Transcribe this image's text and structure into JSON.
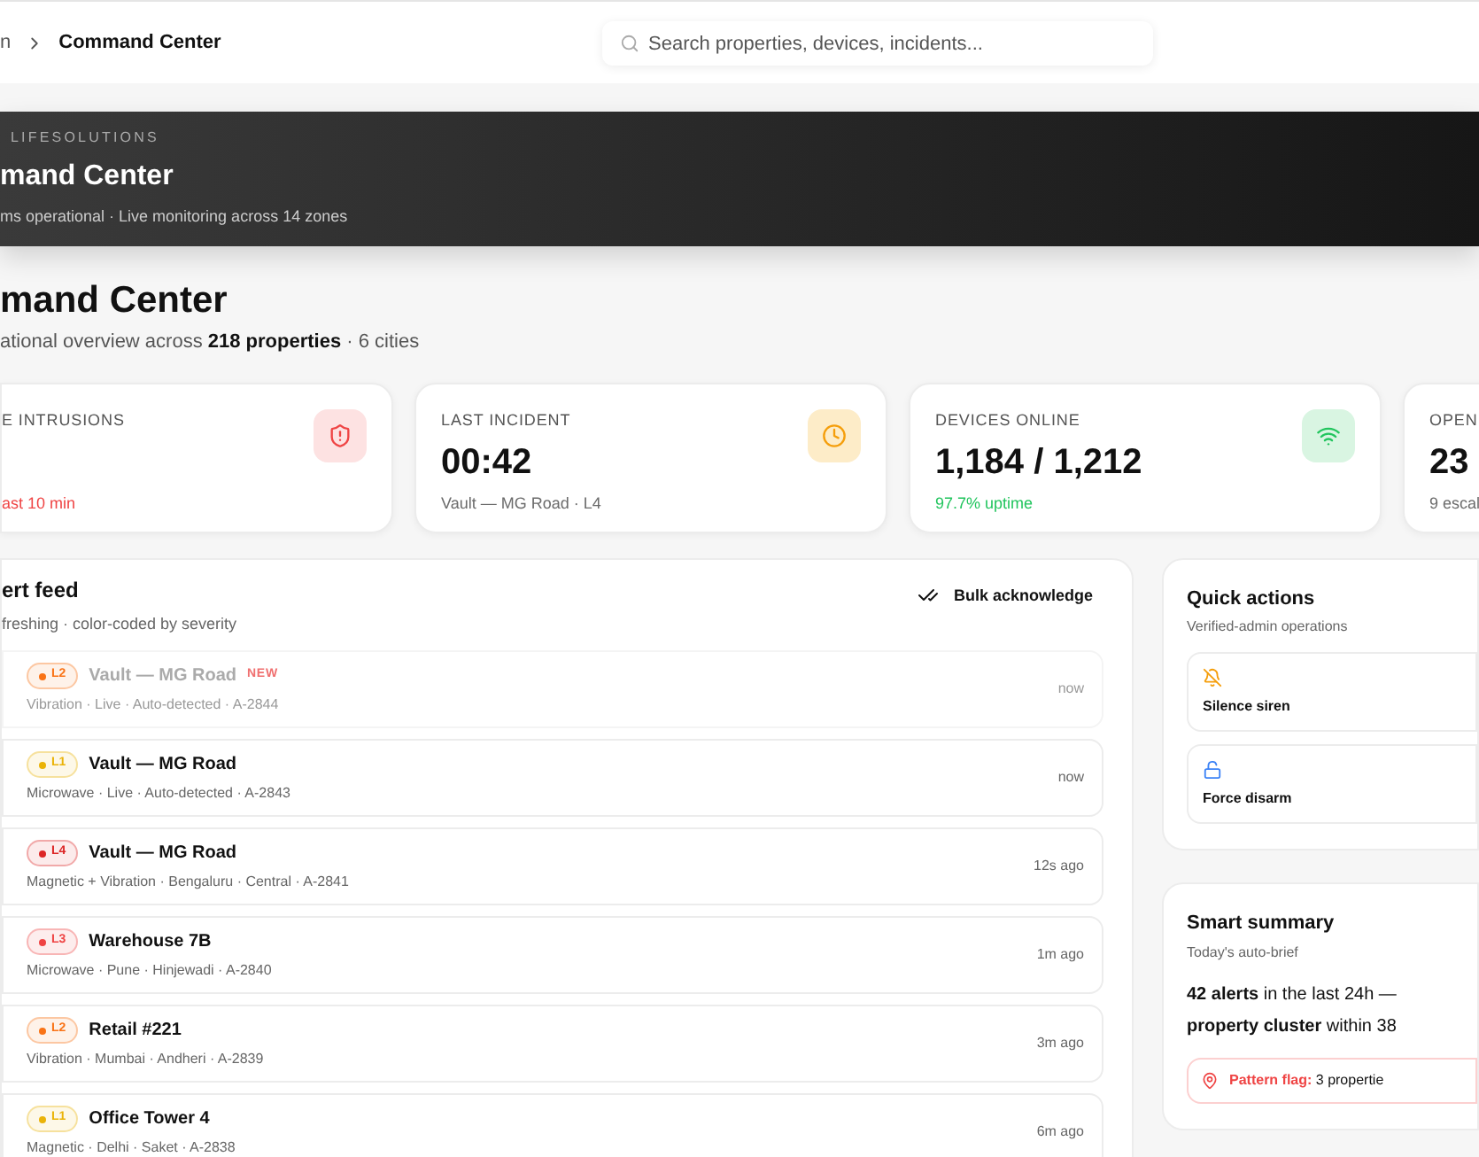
{
  "breadcrumb": {
    "parent": "n",
    "current": "Command Center"
  },
  "search": {
    "placeholder": "Search properties, devices, incidents..."
  },
  "hero": {
    "eyebrow": "LIFESOLUTIONS",
    "title": "mand Center",
    "status": "ms operational · Live monitoring across 14 zones"
  },
  "page": {
    "title": "mand Center",
    "subtitle": "ational overview across **218 properties** · 6 cities"
  },
  "stats": [
    {
      "kind": "intrusions",
      "label": "E INTRUSIONS",
      "note": "ast 10 min"
    },
    {
      "kind": "clock",
      "label": "LAST INCIDENT",
      "value": "00:42",
      "note": "Vault — MG Road · L4"
    },
    {
      "kind": "wifi",
      "label": "DEVICES ONLINE",
      "value": "1,184 / 1,212",
      "note": "97.7% uptime"
    },
    {
      "kind": "none",
      "label": "OPEN",
      "value": "23",
      "note": "9 escal"
    }
  ],
  "alert_feed": {
    "title": "ert feed",
    "subtitle": "freshing · color-coded by severity",
    "action": "Bulk acknowledge",
    "alerts": [
      {
        "level": "L2",
        "color": "#f97316",
        "title": "Vault — MG Road",
        "new_label": "NEW",
        "faded": true,
        "meta": "Vibration · Live · Auto-detected · A-2844",
        "time": "now"
      },
      {
        "level": "L1",
        "color": "#eab308",
        "title": "Vault — MG Road",
        "faded": false,
        "meta": "Microwave · Live · Auto-detected · A-2843",
        "time": "now"
      },
      {
        "level": "L4",
        "color": "#dc2626",
        "title": "Vault — MG Road",
        "faded": false,
        "meta": "Magnetic + Vibration · Bengaluru · Central · A-2841",
        "time": "12s ago"
      },
      {
        "level": "L3",
        "color": "#ef4444",
        "title": "Warehouse 7B",
        "faded": false,
        "meta": "Microwave · Pune · Hinjewadi · A-2840",
        "time": "1m ago"
      },
      {
        "level": "L2",
        "color": "#f97316",
        "title": "Retail #221",
        "faded": false,
        "meta": "Vibration · Mumbai · Andheri · A-2839",
        "time": "3m ago"
      },
      {
        "level": "L1",
        "color": "#eab308",
        "title": "Office Tower 4",
        "faded": false,
        "meta": "Magnetic · Delhi · Saket · A-2838",
        "time": "6m ago"
      }
    ]
  },
  "quick_actions": {
    "title": "Quick actions",
    "subtitle": "Verified-admin operations",
    "actions": [
      {
        "kind": "silence",
        "label": "Silence siren"
      },
      {
        "kind": "disarm",
        "label": "Force disarm"
      }
    ]
  },
  "smart_summary": {
    "title": "Smart summary",
    "subtitle": "Today's auto-brief",
    "lines": [
      "**42 alerts** in the last 24h —",
      "**property cluster** within 38"
    ],
    "flag": "**Pattern flag:** 3 propertie"
  }
}
